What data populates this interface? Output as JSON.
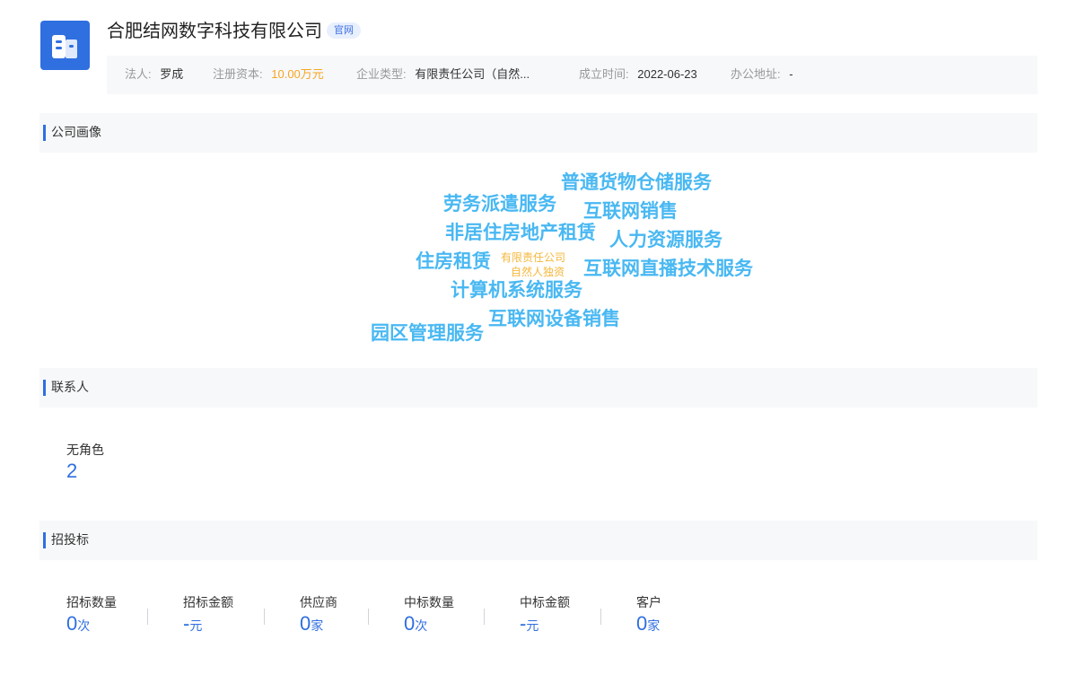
{
  "company": {
    "name": "合肥结网数字科技有限公司",
    "badge": "官网"
  },
  "info": {
    "legal_label": "法人:",
    "legal_value": "罗成",
    "capital_label": "注册资本:",
    "capital_value": "10.00万元",
    "type_label": "企业类型:",
    "type_value": "有限责任公司（自然...",
    "founded_label": "成立时间:",
    "founded_value": "2022-06-23",
    "address_label": "办公地址:",
    "address_value": "-"
  },
  "sections": {
    "portrait": "公司画像",
    "contacts": "联系人",
    "bidding": "招投标"
  },
  "word_cloud": {
    "words": [
      "普通货物仓储服务",
      "劳务派遣服务",
      "互联网销售",
      "非居住房地产租赁",
      "人力资源服务",
      "住房租赁",
      "互联网直播技术服务",
      "计算机系统服务",
      "互联网设备销售",
      "园区管理服务"
    ],
    "small_words": [
      "有限责任公司",
      "自然人独资"
    ],
    "colors": {
      "main": "#49b8f2",
      "small": "#f5b73b"
    }
  },
  "contacts": {
    "role_label": "无角色",
    "role_count": "2"
  },
  "bidding": {
    "stats": [
      {
        "label": "招标数量",
        "value": "0",
        "unit": "次"
      },
      {
        "label": "招标金额",
        "value": "-",
        "unit": "元"
      },
      {
        "label": "供应商",
        "value": "0",
        "unit": "家"
      },
      {
        "label": "中标数量",
        "value": "0",
        "unit": "次"
      },
      {
        "label": "中标金额",
        "value": "-",
        "unit": "元"
      },
      {
        "label": "客户",
        "value": "0",
        "unit": "家"
      }
    ]
  },
  "colors": {
    "accent": "#2f6fe0",
    "capital": "#f5a623"
  }
}
